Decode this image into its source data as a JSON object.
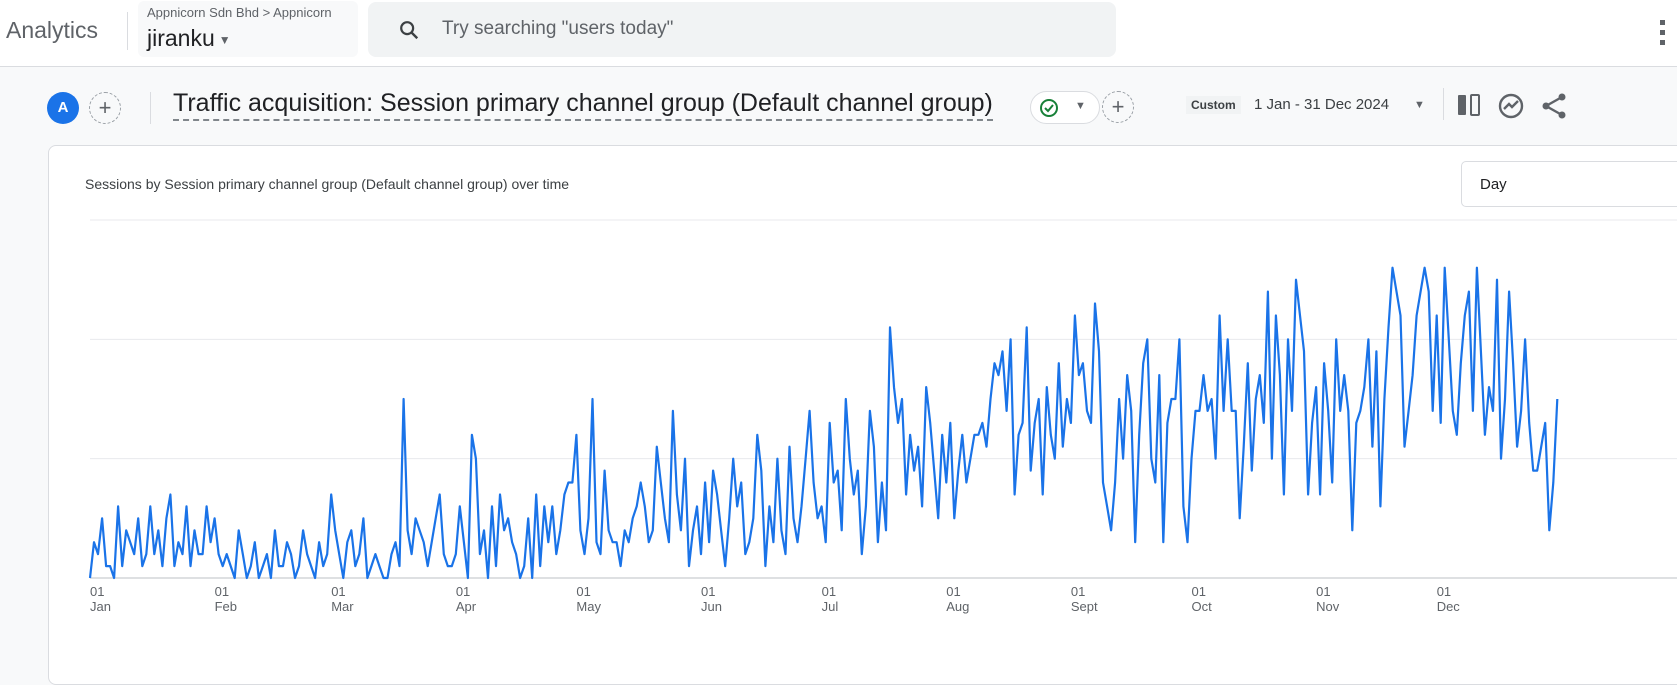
{
  "header": {
    "app_name": "Analytics",
    "breadcrumb": "Appnicorn Sdn Bhd > Appnicorn",
    "property": "jiranku",
    "search_placeholder": "Try searching \"users today\""
  },
  "report": {
    "avatar_letter": "A",
    "title": "Traffic acquisition: Session primary channel group (Default channel group)",
    "status_icon": "check-circle-icon",
    "date_badge": "Custom",
    "date_range": "1 Jan - 31 Dec 2024",
    "toolbar_icons": [
      "compare-icon",
      "insights-icon",
      "share-icon"
    ]
  },
  "card": {
    "title": "Sessions by Session primary channel group (Default channel group) over time",
    "granularity": "Day"
  },
  "colors": {
    "accent": "#1a73e8",
    "line": "#1a73e8"
  },
  "chart_data": {
    "type": "line",
    "title": "Sessions by Session primary channel group (Default channel group) over time",
    "x_start": "2024-01-01",
    "x_end": "2024-12-31",
    "x_interval": "day",
    "ylim": [
      0,
      30
    ],
    "grid": true,
    "legend": "none",
    "tick_day": "01",
    "tick_months": [
      "Jan",
      "Feb",
      "Mar",
      "Apr",
      "May",
      "Jun",
      "Jul",
      "Aug",
      "Sept",
      "Oct",
      "Nov",
      "Dec"
    ],
    "values": [
      0,
      3,
      2,
      5,
      1,
      1,
      0,
      6,
      1,
      4,
      3,
      2,
      5,
      1,
      2,
      6,
      2,
      4,
      1,
      5,
      7,
      1,
      3,
      2,
      6,
      1,
      4,
      2,
      2,
      6,
      3,
      5,
      2,
      1,
      2,
      1,
      0,
      4,
      2,
      0,
      1,
      3,
      0,
      1,
      2,
      0,
      4,
      1,
      1,
      3,
      2,
      0,
      1,
      4,
      2,
      1,
      0,
      3,
      1,
      2,
      7,
      4,
      2,
      0,
      3,
      4,
      1,
      2,
      5,
      0,
      1,
      2,
      1,
      0,
      0,
      2,
      3,
      1,
      15,
      4,
      2,
      5,
      4,
      3,
      1,
      3,
      5,
      7,
      2,
      1,
      1,
      2,
      6,
      3,
      0,
      12,
      10,
      2,
      4,
      0,
      6,
      1,
      7,
      4,
      5,
      3,
      2,
      0,
      1,
      5,
      0,
      7,
      1,
      6,
      3,
      6,
      2,
      4,
      7,
      8,
      8,
      12,
      4,
      2,
      5,
      15,
      3,
      2,
      9,
      4,
      3,
      3,
      1,
      4,
      3,
      5,
      6,
      8,
      6,
      3,
      4,
      11,
      8,
      5,
      3,
      14,
      7,
      4,
      10,
      1,
      4,
      6,
      2,
      8,
      3,
      9,
      7,
      4,
      1,
      5,
      10,
      6,
      8,
      2,
      3,
      5,
      12,
      9,
      1,
      6,
      3,
      10,
      4,
      2,
      11,
      5,
      3,
      6,
      10,
      14,
      8,
      5,
      6,
      3,
      13,
      8,
      9,
      4,
      15,
      10,
      7,
      9,
      2,
      6,
      14,
      11,
      3,
      8,
      4,
      21,
      16,
      13,
      15,
      7,
      12,
      9,
      11,
      6,
      16,
      13,
      9,
      5,
      12,
      8,
      13,
      5,
      9,
      12,
      8,
      10,
      12,
      12,
      13,
      11,
      15,
      18,
      17,
      19,
      14,
      20,
      7,
      12,
      13,
      21,
      9,
      13,
      15,
      7,
      16,
      12,
      10,
      18,
      11,
      15,
      13,
      22,
      17,
      18,
      14,
      13,
      23,
      19,
      8,
      6,
      4,
      8,
      15,
      10,
      17,
      14,
      3,
      12,
      18,
      20,
      10,
      8,
      17,
      3,
      13,
      15,
      15,
      20,
      6,
      3,
      10,
      14,
      14,
      17,
      14,
      15,
      10,
      22,
      14,
      20,
      14,
      14,
      5,
      11,
      18,
      9,
      15,
      17,
      13,
      24,
      10,
      22,
      17,
      7,
      20,
      14,
      25,
      22,
      19,
      7,
      13,
      16,
      7,
      18,
      14,
      8,
      20,
      14,
      17,
      14,
      4,
      13,
      14,
      16,
      20,
      11,
      19,
      6,
      15,
      21,
      26,
      24,
      22,
      11,
      14,
      17,
      22,
      24,
      26,
      24,
      14,
      22,
      13,
      26,
      20,
      14,
      12,
      18,
      22,
      24,
      14,
      26,
      19,
      12,
      16,
      14,
      25,
      10,
      15,
      24,
      18,
      11,
      14,
      20,
      13,
      9,
      9,
      11,
      13,
      4,
      8,
      15
    ]
  }
}
